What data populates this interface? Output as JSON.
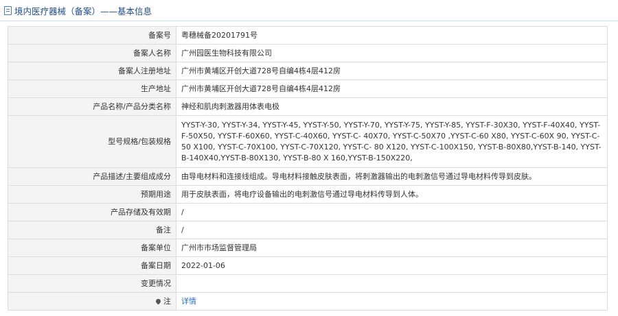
{
  "header": {
    "title": "境内医疗器械（备案）——基本信息",
    "icon": "document-icon"
  },
  "rows": {
    "record_no": {
      "label": "备案号",
      "value": "粤穗械备20201791号"
    },
    "registrant": {
      "label": "备案人名称",
      "value": "广州园医生物科技有限公司"
    },
    "registrant_address": {
      "label": "备案人注册地址",
      "value": "广州市黄埔区开创大道728号自编4栋4层412房"
    },
    "production_address": {
      "label": "生产地址",
      "value": "广州市黄埔区开创大道728号自编4栋4层412房"
    },
    "product_name": {
      "label": "产品名称/产品分类名称",
      "value": "神经和肌肉刺激器用体表电极"
    },
    "model_spec": {
      "label": "型号规格/包装规格",
      "value": "YYST-Y-30, YYST-Y-34, YYST-Y-45, YYST-Y-50, YYST-Y-70, YYST-Y-75, YYST-Y-85, YYST-F-30X30, YYST-F-40X40, YYST-F-50X50, YYST-F-60X60, YYST-C-40X60, YYST-C- 40X70, YYST-C-50X70 ,YYST-C-60 X80, YYST-C-60X 90, YYST-C-50 X100, YYST-C-70X100, YYST-C-70X120, YYST-C- 80 X120, YYST-C-100X150, YYST-B-80X80,YYST-B-140, YYST-B-140X40,YYST-B-80X130, YYST-B-80 X 160,YYST-B-150X220,"
    },
    "description": {
      "label": "产品描述/主要组成成分",
      "value": "由导电材料和连接线组成。导电材料接触皮肤表面，将刺激器输出的电刺激信号通过导电材料传导到皮肤。"
    },
    "intended_use": {
      "label": "预期用途",
      "value": "用于皮肤表面，将电疗设备输出的电刺激信号通过导电材料传导到人体。"
    },
    "storage": {
      "label": "产品存储及有效期",
      "value": "/"
    },
    "remark": {
      "label": "备注",
      "value": "/"
    },
    "record_unit": {
      "label": "备案单位",
      "value": "广州市市场监督管理局"
    },
    "record_date": {
      "label": "备案日期",
      "value": "2022-01-06"
    },
    "change": {
      "label": "变更情况",
      "value": ""
    },
    "note": {
      "label": "注",
      "icon": "location-pin-icon",
      "link": "详情"
    }
  }
}
